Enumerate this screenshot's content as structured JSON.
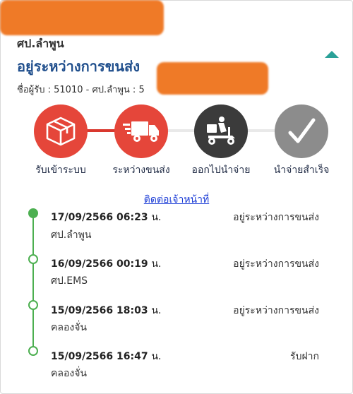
{
  "header": {
    "origin": "ศป.ลำพูน",
    "status": "อยู่ระหว่างการขนส่ง",
    "receiver": "ชื่อผู้รับ : 51010 - ศป.ลำพูน : 5"
  },
  "steps": [
    {
      "label": "รับเข้าระบบ",
      "icon": "parcel-box-icon",
      "color": "#e5463a"
    },
    {
      "label": "ระหว่างขนส่ง",
      "icon": "delivery-truck-icon",
      "color": "#e5463a"
    },
    {
      "label": "ออกไปนำจ่าย",
      "icon": "delivery-scooter-icon",
      "color": "#3b3b3b"
    },
    {
      "label": "นำจ่ายสำเร็จ",
      "icon": "checkmark-icon",
      "color": "#8c8c8c"
    }
  ],
  "contact_link": "ติดต่อเจ้าหน้าที่",
  "time_unit": "น.",
  "events": [
    {
      "datetime": "17/09/2566 06:23",
      "status": "อยู่ระหว่างการขนส่ง",
      "location": "ศป.ลำพูน"
    },
    {
      "datetime": "16/09/2566 00:19",
      "status": "อยู่ระหว่างการขนส่ง",
      "location": "ศป.EMS"
    },
    {
      "datetime": "15/09/2566 18:03",
      "status": "อยู่ระหว่างการขนส่ง",
      "location": "คลองจั่น"
    },
    {
      "datetime": "15/09/2566 16:47",
      "status": "รับฝาก",
      "location": "คลองจั่น"
    }
  ],
  "colors": {
    "accent_red": "#e5463a",
    "title_blue": "#1f4e8c",
    "timeline_green": "#4caf50",
    "link_blue": "#1a3bd6",
    "teal": "#2aa198"
  }
}
